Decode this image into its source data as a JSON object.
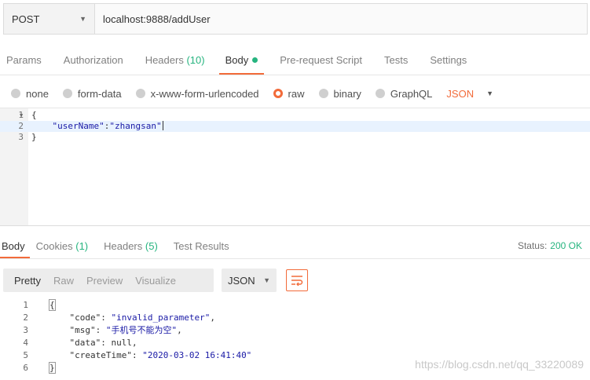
{
  "request": {
    "method": "POST",
    "url": "localhost:9888/addUser"
  },
  "request_tabs": [
    {
      "label": "Params"
    },
    {
      "label": "Authorization"
    },
    {
      "label": "Headers",
      "count": "(10)"
    },
    {
      "label": "Body"
    },
    {
      "label": "Pre-request Script"
    },
    {
      "label": "Tests"
    },
    {
      "label": "Settings"
    }
  ],
  "body_options": [
    "none",
    "form-data",
    "x-www-form-urlencoded",
    "raw",
    "binary",
    "GraphQL"
  ],
  "body_format": "JSON",
  "editor": {
    "lines": [
      "1",
      "2",
      "3"
    ],
    "code": {
      "open": "{",
      "key": "\"userName\"",
      "colon": ":",
      "value": "\"zhangsan\"",
      "close": "}"
    }
  },
  "response_tabs": [
    {
      "label": "Body"
    },
    {
      "label": "Cookies",
      "count": "(1)"
    },
    {
      "label": "Headers",
      "count": "(5)"
    },
    {
      "label": "Test Results"
    }
  ],
  "status": {
    "label": "Status:",
    "code": "200 OK"
  },
  "view_modes": [
    "Pretty",
    "Raw",
    "Preview",
    "Visualize"
  ],
  "response_format": "JSON",
  "response": {
    "lines": [
      "1",
      "2",
      "3",
      "4",
      "5",
      "6"
    ],
    "open": "{",
    "close": "}",
    "rows": [
      {
        "key": "\"code\"",
        "value": "\"invalid_parameter\"",
        "tail": ","
      },
      {
        "key": "\"msg\"",
        "value": "\"手机号不能为空\"",
        "tail": ","
      },
      {
        "key": "\"data\"",
        "value": "null",
        "tail": ","
      },
      {
        "key": "\"createTime\"",
        "value": "\"2020-03-02 16:41:40\"",
        "tail": ""
      }
    ]
  },
  "watermark": "https://blog.csdn.net/qq_33220089",
  "colors": {
    "accent": "#f26b3a",
    "success": "#26b47f"
  }
}
